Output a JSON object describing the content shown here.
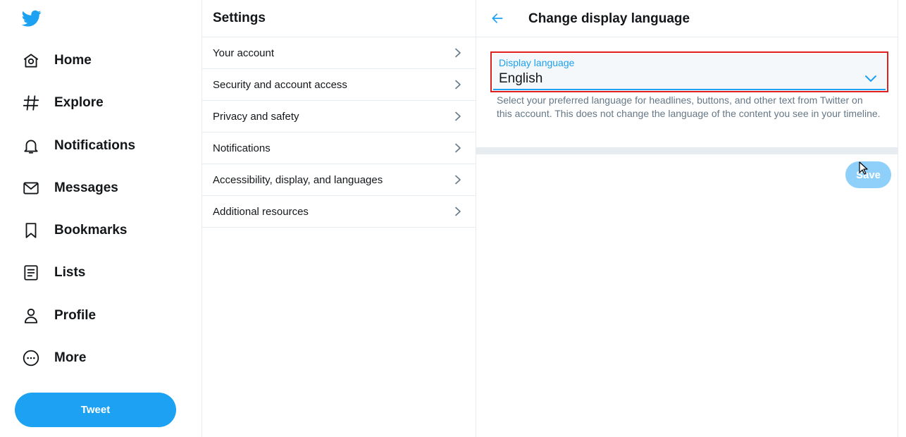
{
  "brand": {
    "accent": "#1da1f2",
    "text": "#14171a",
    "muted": "#657786",
    "border": "#e6ecf0",
    "highlight": "#e0201e"
  },
  "nav": {
    "logo_icon": "twitter-bird-icon",
    "items": [
      {
        "label": "Home",
        "icon": "home-icon"
      },
      {
        "label": "Explore",
        "icon": "hashtag-icon"
      },
      {
        "label": "Notifications",
        "icon": "bell-icon"
      },
      {
        "label": "Messages",
        "icon": "envelope-icon"
      },
      {
        "label": "Bookmarks",
        "icon": "bookmark-icon"
      },
      {
        "label": "Lists",
        "icon": "list-icon"
      },
      {
        "label": "Profile",
        "icon": "person-icon"
      },
      {
        "label": "More",
        "icon": "more-circle-icon"
      }
    ],
    "tweet_label": "Tweet"
  },
  "settings": {
    "title": "Settings",
    "items": [
      {
        "label": "Your account"
      },
      {
        "label": "Security and account access"
      },
      {
        "label": "Privacy and safety"
      },
      {
        "label": "Notifications"
      },
      {
        "label": "Accessibility, display, and languages"
      },
      {
        "label": "Additional resources"
      }
    ]
  },
  "detail": {
    "title": "Change display language",
    "field": {
      "label": "Display language",
      "value": "English"
    },
    "help_text": "Select your preferred language for headlines, buttons, and other text from Twitter on this account. This does not change the language of the content you see in your timeline.",
    "save_label": "Save"
  }
}
